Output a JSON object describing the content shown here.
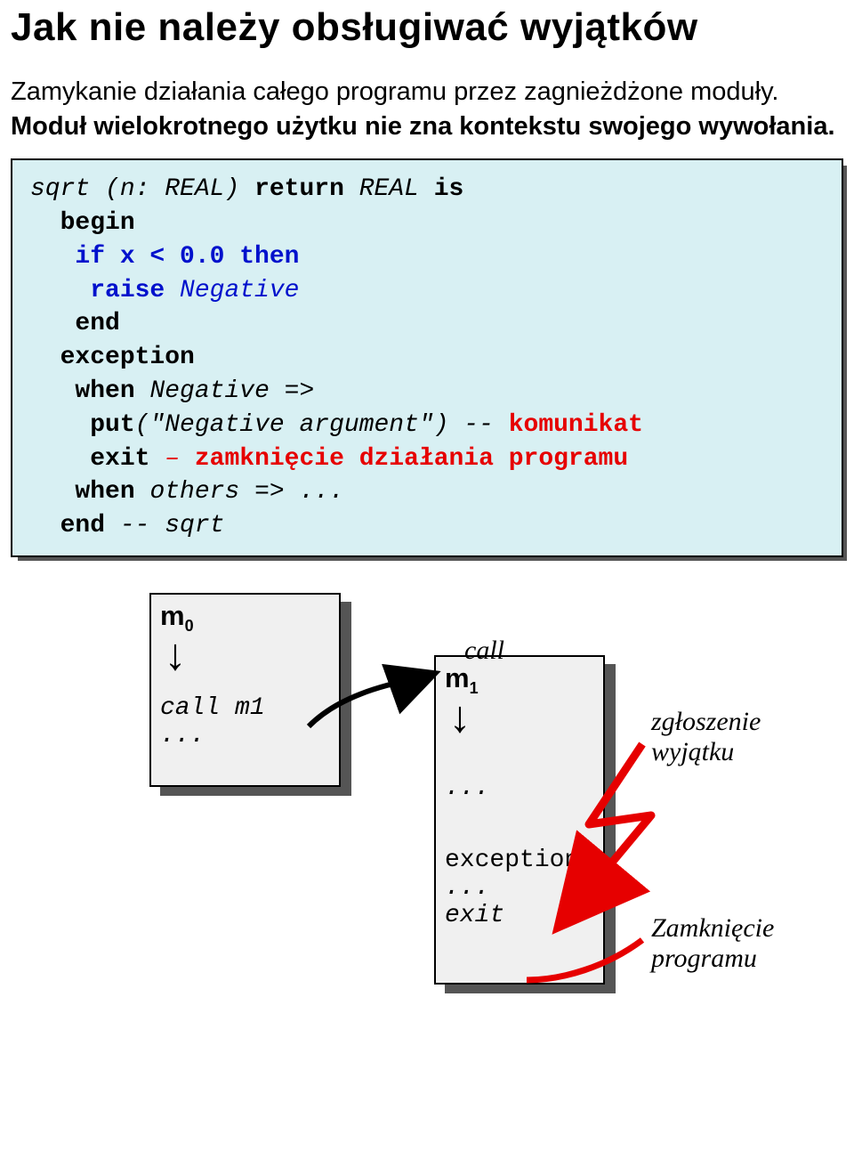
{
  "title": "Jak nie należy obsługiwać wyjątków",
  "para": {
    "part1": "Zamykanie działania całego programu przez zagnieżdżone moduły. ",
    "part2": "Moduł wielokrotnego użytku nie zna kontekstu swojego wywołania."
  },
  "code": {
    "sig_sqrt": "sqrt",
    "sig_paren_open": " (n: REAL) ",
    "kw_return": "return",
    "sig_after_return": " REAL ",
    "kw_is": "is",
    "kw_begin": "begin",
    "kw_if": "if x < 0.0 then",
    "kw_raise": "raise",
    "raise_arg": " Negative",
    "kw_end": "end",
    "kw_exception": "exception",
    "kw_when": "when",
    "when_arg": " Negative =>",
    "kw_put": "put",
    "put_arg": "(\"Negative argument\") -- ",
    "put_red": "komunikat",
    "kw_exit": "exit",
    "exit_dash": " – ",
    "exit_red": "zamknięcie działania programu",
    "kw_when2": "when",
    "when2_arg": " others => ...",
    "kw_endfinal": "end",
    "end_tail": " -- sqrt"
  },
  "diagram": {
    "m0_label": "m",
    "m0_sub": "0",
    "m0_call": "call m1",
    "m0_dots": "...",
    "m1_label": "m",
    "m1_sub": "1",
    "m1_dots": "...",
    "m1_exception": "exception",
    "m1_dots2": "...",
    "m1_exit": "exit",
    "call_label": "call",
    "ann1a": "zgłoszenie",
    "ann1b": "wyjątku",
    "ann2a": "Zamknięcie",
    "ann2b": "programu"
  }
}
